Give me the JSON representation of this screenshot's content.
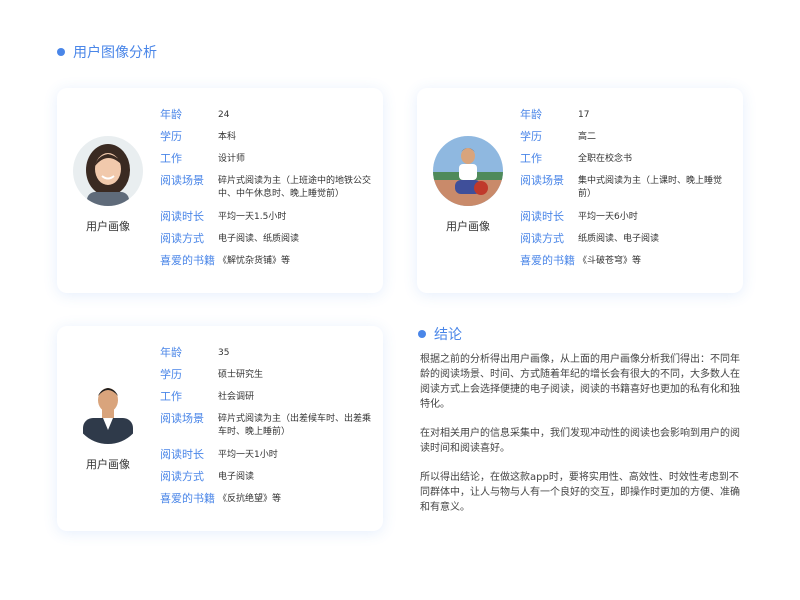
{
  "section_title": "用户图像分析",
  "conclusion_title": "结论",
  "avatar_label": "用户画像",
  "labels": {
    "age": "年龄",
    "education": "学历",
    "job": "工作",
    "scene": "阅读场景",
    "duration": "阅读时长",
    "method": "阅读方式",
    "books": "喜爱的书籍"
  },
  "personas": [
    {
      "age": "24",
      "education": "本科",
      "job": "设计师",
      "scene": "碎片式阅读为主（上班途中的地铁公交中、中午休息时、晚上睡觉前）",
      "duration": "平均一天1.5小时",
      "method": "电子阅读、纸质阅读",
      "books": "《解忧杂货铺》等"
    },
    {
      "age": "17",
      "education": "高二",
      "job": "全职在校念书",
      "scene": "集中式阅读为主（上课时、晚上睡觉前）",
      "duration": "平均一天6小时",
      "method": "纸质阅读、电子阅读",
      "books": "《斗破苍穹》等"
    },
    {
      "age": "35",
      "education": "硕士研究生",
      "job": "社会调研",
      "scene": "碎片式阅读为主（出差候车时、出差乘车时、晚上睡前）",
      "duration": "平均一天1小时",
      "method": "电子阅读",
      "books": "《反抗绝望》等"
    }
  ],
  "conclusion": [
    "根据之前的分析得出用户画像，从上面的用户画像分析我们得出：不同年龄的阅读场景、时间、方式随着年纪的增长会有很大的不同，大多数人在阅读方式上会选择便捷的电子阅读，阅读的书籍喜好也更加的私有化和独特化。",
    "在对相关用户的信息采集中，我们发现冲动性的阅读也会影响到用户的阅读时间和阅读喜好。",
    "所以得出结论，在做这款app时，要将实用性、高效性、时效性考虑到不同群体中，让人与物与人有一个良好的交互，即操作时更加的方便、准确和有意义。"
  ],
  "colors": {
    "accent": "#4a86e8",
    "text": "#333333"
  }
}
